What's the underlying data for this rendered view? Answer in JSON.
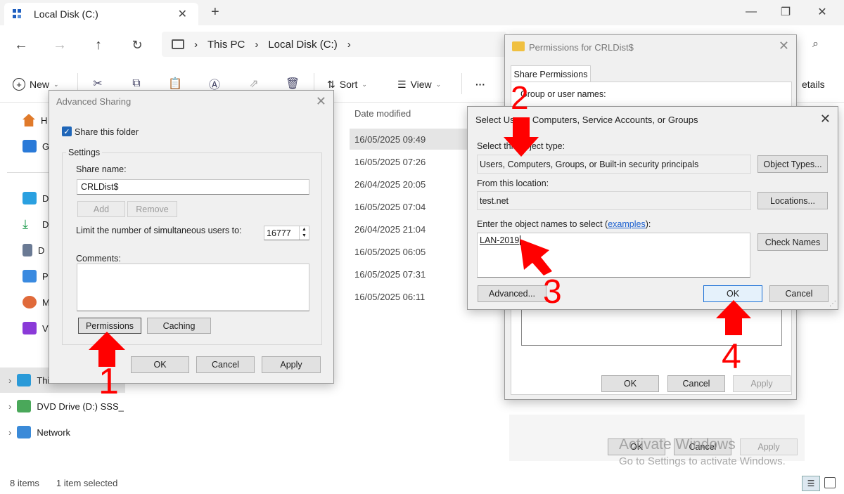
{
  "explorer": {
    "tab_title": "Local Disk (C:)",
    "new_tab": "+",
    "breadcrumb": [
      "This PC",
      "Local Disk (C:)"
    ],
    "commands": {
      "new": "New",
      "sort": "Sort",
      "view": "View",
      "more": "···",
      "details": "etails"
    },
    "nav": {
      "home": "H",
      "gallery": "G",
      "desktop": "D",
      "downloads": "D",
      "documents": "D",
      "pictures": "P",
      "music": "M",
      "videos": "V",
      "this_pc": "This PC",
      "dvd": "DVD Drive (D:) SSS_",
      "network": "Network"
    },
    "column_date": "Date modified",
    "dates": [
      "16/05/2025 09:49",
      "16/05/2025 07:26",
      "26/04/2025 20:05",
      "16/05/2025 07:04",
      "26/04/2025 21:04",
      "16/05/2025 06:05",
      "16/05/2025 07:31",
      "16/05/2025 06:11"
    ],
    "status": {
      "items": "8 items",
      "selected": "1 item selected"
    }
  },
  "advanced_sharing": {
    "title": "Advanced Sharing",
    "share_checkbox": "Share this folder",
    "settings_label": "Settings",
    "share_name_label": "Share name:",
    "share_name_value": "CRLDist$",
    "add": "Add",
    "remove": "Remove",
    "limit_label": "Limit the number of simultaneous users to:",
    "limit_value": "16777",
    "comments_label": "Comments:",
    "permissions": "Permissions",
    "caching": "Caching",
    "ok": "OK",
    "cancel": "Cancel",
    "apply": "Apply"
  },
  "permissions": {
    "title": "Permissions for CRLDist$",
    "tab": "Share Permissions",
    "group_label": "Group or user names:",
    "ok": "OK",
    "cancel": "Cancel",
    "apply": "Apply"
  },
  "bg_dialog": {
    "ok": "OK",
    "cancel": "Cancel",
    "apply": "Apply"
  },
  "select_users": {
    "title": "Select Users, Computers, Service Accounts, or Groups",
    "object_type_label": "Select this object type:",
    "object_type_value": "Users, Computers, Groups, or Built-in security principals",
    "object_types_btn": "Object Types...",
    "location_label": "From this location:",
    "location_value": "test.net",
    "locations_btn": "Locations...",
    "enter_label_pre": "Enter the object names to select (",
    "enter_label_link": "examples",
    "enter_label_post": "):",
    "names_value": "LAN-2019",
    "check_names": "Check Names",
    "advanced": "Advanced...",
    "ok": "OK",
    "cancel": "Cancel"
  },
  "watermark": {
    "line1": "Activate Windows",
    "line2": "Go to Settings to activate Windows."
  },
  "annotations": {
    "step1": "1",
    "step2": "2",
    "step3": "3",
    "step4": "4",
    "color": "#ff0000"
  }
}
